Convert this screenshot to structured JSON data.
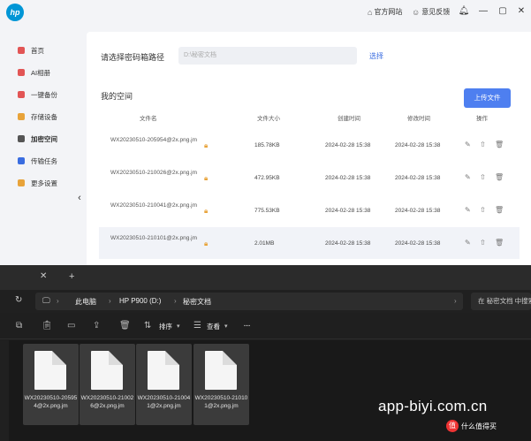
{
  "app": {
    "logo_text": "hp",
    "links": {
      "website": "官方网站",
      "feedback": "意见反馈"
    },
    "sidebar": [
      {
        "label": "首页",
        "color": "#e25555"
      },
      {
        "label": "AI相册",
        "color": "#e25555"
      },
      {
        "label": "一键备份",
        "color": "#e25555"
      },
      {
        "label": "存储设备",
        "color": "#e8a33a"
      },
      {
        "label": "加密空间",
        "color": "#555555"
      },
      {
        "label": "传输任务",
        "color": "#3a6de0"
      },
      {
        "label": "更多设置",
        "color": "#e8a33a"
      }
    ],
    "path_label": "请选择密码箱路径",
    "path_value": "D:\\秘密文档",
    "browse_label": "选择",
    "space_title": "我的空间",
    "upload_label": "上传文件",
    "columns": {
      "name": "文件名",
      "size": "文件大小",
      "created": "创建时间",
      "modified": "修改时间",
      "actions": "操作"
    },
    "files": [
      {
        "name": "WX20230510-205954@2x.png.jm",
        "size": "185.78KB",
        "created": "2024-02-28 15:38",
        "modified": "2024-02-28 15:38"
      },
      {
        "name": "WX20230510-210026@2x.png.jm",
        "size": "472.95KB",
        "created": "2024-02-28 15:38",
        "modified": "2024-02-28 15:38"
      },
      {
        "name": "WX20230510-210041@2x.png.jm",
        "size": "775.53KB",
        "created": "2024-02-28 15:38",
        "modified": "2024-02-28 15:38"
      },
      {
        "name": "WX20230510-210101@2x.png.jm",
        "size": "2.01MB",
        "created": "2024-02-28 15:38",
        "modified": "2024-02-28 15:38"
      }
    ]
  },
  "explorer": {
    "breadcrumb": [
      "此电脑",
      "HP P900 (D:)",
      "秘密文档"
    ],
    "search_placeholder": "在 秘密文档 中搜索",
    "toolbar": {
      "sort": "排序",
      "view": "查看",
      "more": "···"
    },
    "files": [
      {
        "label": "WX20230510-205954@2x.png.jm"
      },
      {
        "label": "WX20230510-210026@2x.png.jm"
      },
      {
        "label": "WX20230510-210041@2x.png.jm"
      },
      {
        "label": "WX20230510-210101@2x.png.jm"
      }
    ]
  },
  "watermark": {
    "site": "app-biyi.com.cn",
    "tag": "什么值得买"
  }
}
